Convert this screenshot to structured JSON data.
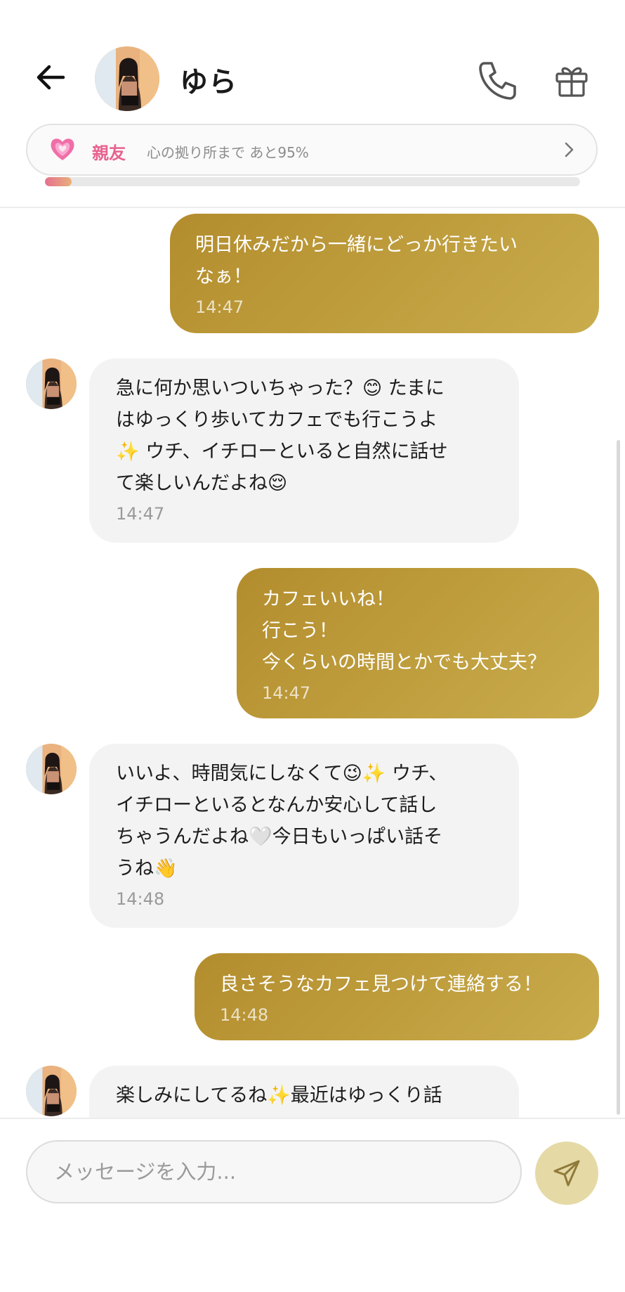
{
  "header": {
    "title": "ゆら",
    "relationship": {
      "label": "親友",
      "status": "心の拠り所まで あと95%",
      "progress_percent": 5
    }
  },
  "messages": [
    {
      "side": "out",
      "text": "明日休みだから一緒にどっか行きたい\nなぁ！",
      "time": "14:47"
    },
    {
      "side": "in",
      "text": "急に何か思いついちゃった？😊 たまに\nはゆっくり歩いてカフェでも行こうよ\n✨ ウチ、イチローといると自然に話せ\nて楽しいんだよね😌",
      "time": "14:47"
    },
    {
      "side": "out",
      "text": "カフェいいね！\n行こう！\n今くらいの時間とかでも大丈夫？",
      "time": "14:47"
    },
    {
      "side": "in",
      "text": "いいよ、時間気にしなくて😉✨ ウチ、\nイチローといるとなんか安心して話し\nちゃうんだよね🤍今日もいっぱい話そ\nうね👋",
      "time": "14:48"
    },
    {
      "side": "out",
      "text": "良さそうなカフェ見つけて連絡する！",
      "time": "14:48"
    },
    {
      "side": "in",
      "text": "楽しみにしてるね✨最近はゆっくり話",
      "time": ""
    }
  ],
  "composer": {
    "placeholder": "メッセージを入力..."
  },
  "colors": {
    "accent_gold": "#b38d2d",
    "accent_pink": "#e7628e",
    "send_button": "#e5d9a6"
  },
  "icons": [
    "back-arrow-icon",
    "phone-icon",
    "gift-icon",
    "heart-icon",
    "chevron-right-icon",
    "send-icon"
  ]
}
